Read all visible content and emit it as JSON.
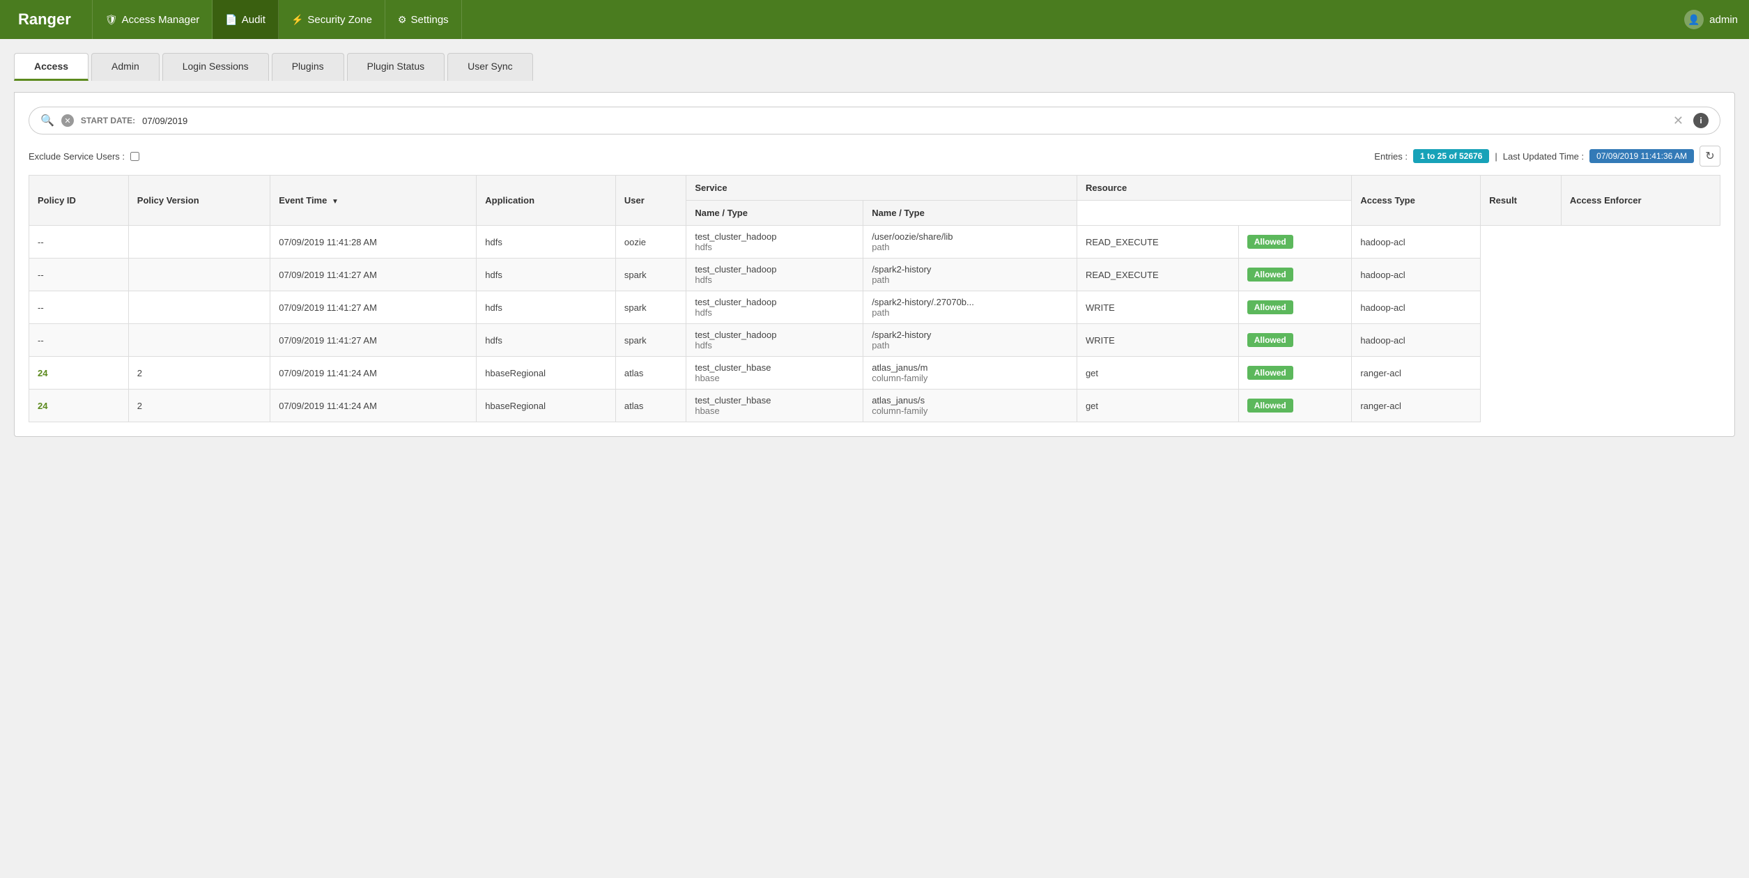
{
  "app": {
    "brand": "Ranger",
    "nav_items": [
      {
        "label": "Access Manager",
        "icon": "🛡",
        "active": false
      },
      {
        "label": "Audit",
        "icon": "📄",
        "active": true
      },
      {
        "label": "Security Zone",
        "icon": "⚡",
        "active": false
      },
      {
        "label": "Settings",
        "icon": "⚙",
        "active": false
      }
    ],
    "user": "admin"
  },
  "tabs": [
    {
      "label": "Access",
      "active": true
    },
    {
      "label": "Admin",
      "active": false
    },
    {
      "label": "Login Sessions",
      "active": false
    },
    {
      "label": "Plugins",
      "active": false
    },
    {
      "label": "Plugin Status",
      "active": false
    },
    {
      "label": "User Sync",
      "active": false
    }
  ],
  "search": {
    "start_date_label": "START DATE:",
    "start_date_value": "07/09/2019"
  },
  "filter": {
    "exclude_label": "Exclude Service Users :",
    "entries_label": "Entries :",
    "entries_value": "1 to 25 of 52676",
    "last_updated_label": "Last Updated Time :",
    "last_updated_value": "07/09/2019 11:41:36 AM"
  },
  "table": {
    "headers": {
      "policy_id": "Policy ID",
      "policy_version": "Policy Version",
      "event_time": "Event Time",
      "application": "Application",
      "user": "User",
      "service_group": "Service",
      "service_name_type": "Name / Type",
      "resource_group": "Resource",
      "resource_name_type": "Name / Type",
      "access_type": "Access Type",
      "result": "Result",
      "access_enforcer": "Access Enforcer"
    },
    "rows": [
      {
        "policy_id": "--",
        "policy_version": "",
        "event_time": "07/09/2019 11:41:28 AM",
        "application": "hdfs",
        "user": "oozie",
        "service_name": "test_cluster_hadoop",
        "service_type": "hdfs",
        "resource_name": "/user/oozie/share/lib",
        "resource_type": "path",
        "access_type": "READ_EXECUTE",
        "result": "Allowed",
        "access_enforcer": "hadoop-acl",
        "extra": "a27"
      },
      {
        "policy_id": "--",
        "policy_version": "",
        "event_time": "07/09/2019 11:41:27 AM",
        "application": "hdfs",
        "user": "spark",
        "service_name": "test_cluster_hadoop",
        "service_type": "hdfs",
        "resource_name": "/spark2-history",
        "resource_type": "path",
        "access_type": "READ_EXECUTE",
        "result": "Allowed",
        "access_enforcer": "hadoop-acl",
        "extra": "a27"
      },
      {
        "policy_id": "--",
        "policy_version": "",
        "event_time": "07/09/2019 11:41:27 AM",
        "application": "hdfs",
        "user": "spark",
        "service_name": "test_cluster_hadoop",
        "service_type": "hdfs",
        "resource_name": "/spark2-history/.27070b...",
        "resource_type": "path",
        "access_type": "WRITE",
        "result": "Allowed",
        "access_enforcer": "hadoop-acl",
        "extra": "a27"
      },
      {
        "policy_id": "--",
        "policy_version": "",
        "event_time": "07/09/2019 11:41:27 AM",
        "application": "hdfs",
        "user": "spark",
        "service_name": "test_cluster_hadoop",
        "service_type": "hdfs",
        "resource_name": "/spark2-history",
        "resource_type": "path",
        "access_type": "WRITE",
        "result": "Allowed",
        "access_enforcer": "hadoop-acl",
        "extra": "a27"
      },
      {
        "policy_id": "24",
        "policy_version": "2",
        "event_time": "07/09/2019 11:41:24 AM",
        "application": "hbaseRegional",
        "user": "atlas",
        "service_name": "test_cluster_hbase",
        "service_type": "hbase",
        "resource_name": "atlas_janus/m",
        "resource_type": "column-family",
        "access_type": "get",
        "result": "Allowed",
        "access_enforcer": "ranger-acl",
        "extra": "a27"
      },
      {
        "policy_id": "24",
        "policy_version": "2",
        "event_time": "07/09/2019 11:41:24 AM",
        "application": "hbaseRegional",
        "user": "atlas",
        "service_name": "test_cluster_hbase",
        "service_type": "hbase",
        "resource_name": "atlas_janus/s",
        "resource_type": "column-family",
        "access_type": "get",
        "result": "Allowed",
        "access_enforcer": "ranger-acl",
        "extra": "a27"
      }
    ]
  }
}
